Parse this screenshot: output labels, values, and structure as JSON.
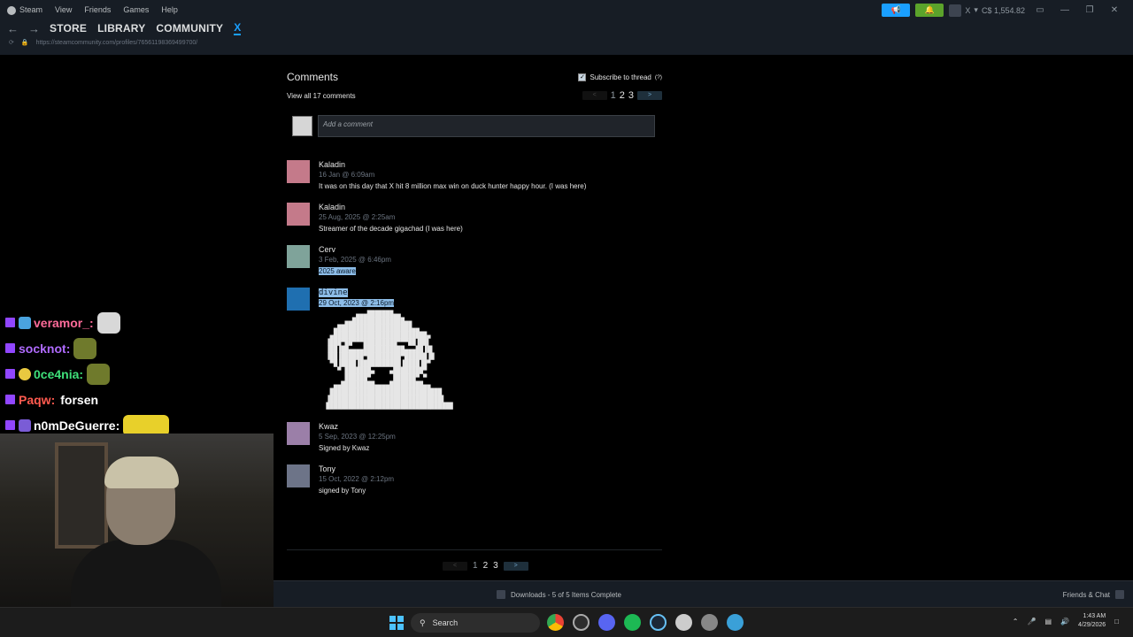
{
  "menu": {
    "items": [
      "Steam",
      "View",
      "Friends",
      "Games",
      "Help"
    ]
  },
  "nav": {
    "tabs": [
      "STORE",
      "LIBRARY",
      "COMMUNITY",
      "X"
    ]
  },
  "url": "https://steamcommunity.com/profiles/76561198369499700/",
  "account": {
    "name": "X",
    "balance": "C$ 1,554.82"
  },
  "comments": {
    "title": "Comments",
    "subscribe_label": "Subscribe to thread",
    "help_mark": "(?)",
    "view_all": "View all 17 comments",
    "pages": [
      "1",
      "2",
      "3"
    ],
    "prev": "<",
    "next": ">",
    "placeholder": "Add a comment",
    "items": [
      {
        "author": "Kaladin",
        "date": "16 Jan @ 6:09am",
        "text": "It was on this day that X hit 8 million max win on duck hunter happy hour. (I was here)"
      },
      {
        "author": "Kaladin",
        "date": "25 Aug, 2025 @ 2:25am",
        "text": "Streamer of the decade gigachad (I was here)"
      },
      {
        "author": "Cerv",
        "date": "3 Feb, 2025 @ 6:46pm",
        "text": "2025 aware"
      },
      {
        "author": "divine",
        "date": "29 Oct, 2023 @ 2:16pm",
        "text": ""
      },
      {
        "author": "Kwaz",
        "date": "5 Sep, 2023 @ 12:25pm",
        "text": "Signed by Kwaz"
      },
      {
        "author": "Tony",
        "date": "15 Oct, 2022 @ 2:12pm",
        "text": "signed by Tony"
      }
    ]
  },
  "chat": [
    {
      "user": "veramor_",
      "color": "#ff6b9a",
      "message": ""
    },
    {
      "user": "socknot",
      "color": "#b06bff",
      "message": ""
    },
    {
      "user": "0ce4nia",
      "color": "#3fe07a",
      "message": ""
    },
    {
      "user": "Paqw",
      "color": "#ff5a4f",
      "message": "forsen"
    },
    {
      "user": "n0mDeGuerre",
      "color": "#ffffff",
      "message": ""
    }
  ],
  "status": {
    "downloads": "Downloads - 5 of 5 Items Complete",
    "friends": "Friends & Chat"
  },
  "taskbar": {
    "search": "Search",
    "time": "1:43 AM",
    "date": "4/29/2026"
  }
}
